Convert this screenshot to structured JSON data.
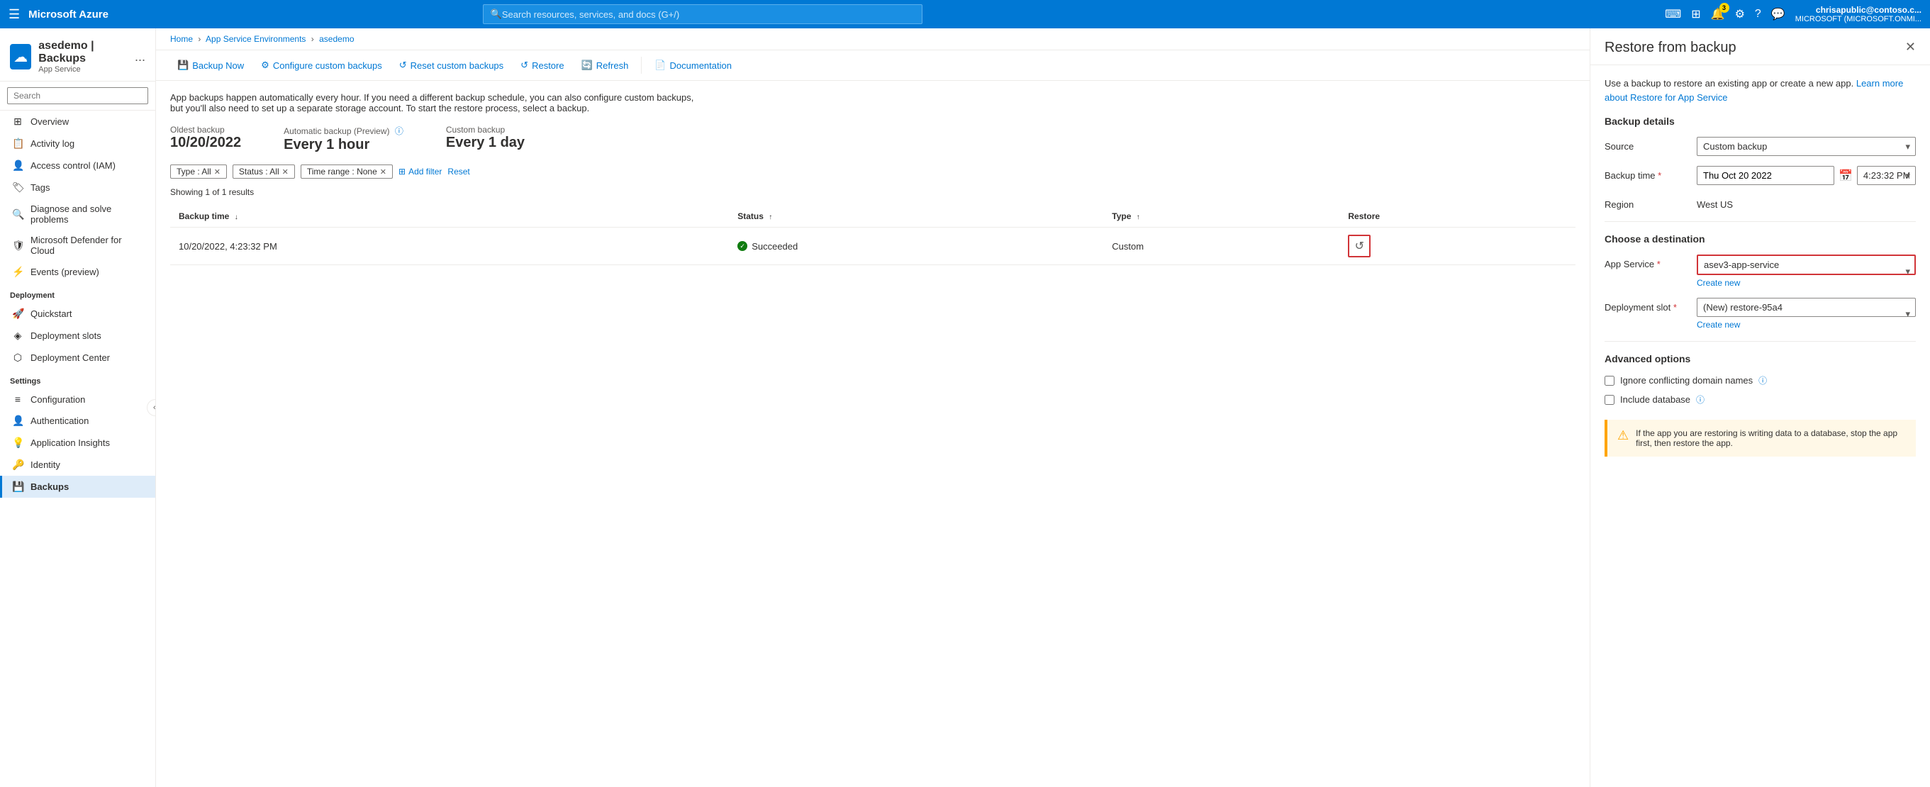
{
  "topNav": {
    "brand": "Microsoft Azure",
    "search_placeholder": "Search resources, services, and docs (G+/)",
    "notification_count": "3",
    "user_name": "chrisapublic@contoso.c...",
    "user_tenant": "MICROSOFT (MICROSOFT.ONMI..."
  },
  "breadcrumb": {
    "home": "Home",
    "service_environments": "App Service Environments",
    "current": "asedemo"
  },
  "pageHeader": {
    "title": "asedemo | Backups",
    "subtitle": "App Service",
    "ellipsis": "..."
  },
  "sidebar": {
    "search_placeholder": "Search",
    "items": [
      {
        "id": "overview",
        "label": "Overview",
        "icon": "⊞"
      },
      {
        "id": "activity-log",
        "label": "Activity log",
        "icon": "📋"
      },
      {
        "id": "access-control",
        "label": "Access control (IAM)",
        "icon": "👤"
      },
      {
        "id": "tags",
        "label": "Tags",
        "icon": "🏷"
      },
      {
        "id": "diagnose",
        "label": "Diagnose and solve problems",
        "icon": "🔍"
      },
      {
        "id": "defender",
        "label": "Microsoft Defender for Cloud",
        "icon": "🛡"
      },
      {
        "id": "events",
        "label": "Events (preview)",
        "icon": "⚡"
      }
    ],
    "sections": [
      {
        "label": "Deployment",
        "items": [
          {
            "id": "quickstart",
            "label": "Quickstart",
            "icon": "🚀"
          },
          {
            "id": "deployment-slots",
            "label": "Deployment slots",
            "icon": "◈"
          },
          {
            "id": "deployment-center",
            "label": "Deployment Center",
            "icon": "⬡"
          }
        ]
      },
      {
        "label": "Settings",
        "items": [
          {
            "id": "configuration",
            "label": "Configuration",
            "icon": "≡"
          },
          {
            "id": "authentication",
            "label": "Authentication",
            "icon": "👤"
          },
          {
            "id": "app-insights",
            "label": "Application Insights",
            "icon": "💡"
          },
          {
            "id": "identity",
            "label": "Identity",
            "icon": "🔑"
          },
          {
            "id": "backups",
            "label": "Backups",
            "icon": "💾",
            "active": true
          }
        ]
      }
    ]
  },
  "toolbar": {
    "backup_now": "Backup Now",
    "configure_backups": "Configure custom backups",
    "reset_backups": "Reset custom backups",
    "restore": "Restore",
    "refresh": "Refresh",
    "documentation": "Documentation"
  },
  "content": {
    "description": "App backups happen automatically every hour. If you need a different backup schedule, you can also configure custom backups, but you'll also need to set up a separate storage account. To start the restore process, select a backup.",
    "backup_summary": {
      "oldest_label": "Oldest backup",
      "oldest_value": "10/20/2022",
      "auto_label": "Automatic backup (Preview)",
      "auto_value": "Every 1 hour",
      "custom_label": "Custom backup",
      "custom_value": "Every 1 day"
    },
    "filters": [
      {
        "label": "Type : All"
      },
      {
        "label": "Status : All"
      },
      {
        "label": "Time range : None"
      }
    ],
    "add_filter": "Add filter",
    "reset": "Reset",
    "results_count": "Showing 1 of 1 results",
    "table": {
      "columns": [
        {
          "label": "Backup time",
          "sort": "↓"
        },
        {
          "label": "Status",
          "sort": "↑"
        },
        {
          "label": "Type",
          "sort": "↑"
        },
        {
          "label": "Restore",
          "sort": ""
        }
      ],
      "rows": [
        {
          "backup_time": "10/20/2022, 4:23:32 PM",
          "status": "Succeeded",
          "type": "Custom"
        }
      ]
    }
  },
  "rightPanel": {
    "title": "Restore from backup",
    "description": "Use a backup to restore an existing app or create a new app.",
    "learn_more": "Learn more about Restore for App Service",
    "section_backup": "Backup details",
    "source_label": "Source",
    "source_value": "Custom backup",
    "backup_time_label": "Backup time",
    "backup_time_date": "Thu Oct 20 2022",
    "backup_time_time": "4:23:32 PM",
    "region_label": "Region",
    "region_value": "West US",
    "section_destination": "Choose a destination",
    "app_service_label": "App Service",
    "app_service_value": "asev3-app-service",
    "create_new_app": "Create new",
    "deployment_slot_label": "Deployment slot",
    "deployment_slot_value": "(New) restore-95a4",
    "create_new_slot": "Create new",
    "section_advanced": "Advanced options",
    "ignore_domain": "Ignore conflicting domain names",
    "include_database": "Include database",
    "warning_text": "If the app you are restoring is writing data to a database, stop the app first, then restore the app."
  }
}
